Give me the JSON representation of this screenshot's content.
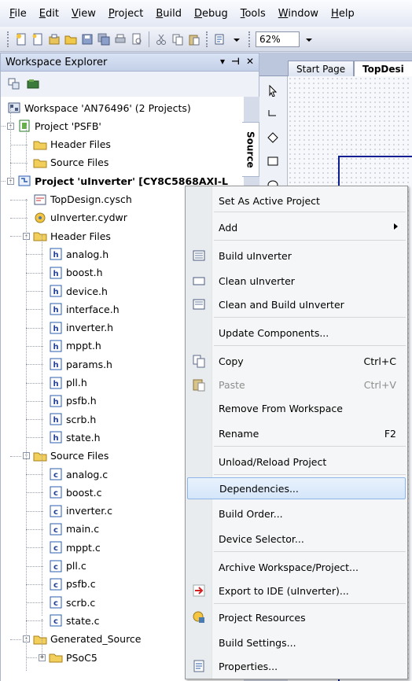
{
  "menubar": [
    "File",
    "Edit",
    "View",
    "Project",
    "Build",
    "Debug",
    "Tools",
    "Window",
    "Help"
  ],
  "toolbar": {
    "zoom": "62%"
  },
  "workspace_panel": {
    "title": "Workspace Explorer",
    "pin_label": "▾ ⊣ ✕",
    "side_tab": "Source"
  },
  "tree": {
    "workspace": "Workspace 'AN76496' (2 Projects)",
    "psfb_project": "Project 'PSFB'",
    "psfb_header": "Header Files",
    "psfb_source": "Source Files",
    "uinverter_project": "Project 'uInverter' [CY8C5868AXI-L",
    "topdesign": "TopDesign.cysch",
    "cydwr": "uInverter.cydwr",
    "header_files": "Header Files",
    "headers": [
      "analog.h",
      "boost.h",
      "device.h",
      "interface.h",
      "inverter.h",
      "mppt.h",
      "params.h",
      "pll.h",
      "psfb.h",
      "scrb.h",
      "state.h"
    ],
    "source_files": "Source Files",
    "sources": [
      "analog.c",
      "boost.c",
      "inverter.c",
      "main.c",
      "mppt.c",
      "pll.c",
      "psfb.c",
      "scrb.c",
      "state.c"
    ],
    "generated": "Generated_Source",
    "psoc5": "PSoC5"
  },
  "tabs": {
    "start": "Start Page",
    "design": "TopDesi"
  },
  "context_menu": {
    "set_active": "Set As Active Project",
    "add": "Add",
    "build": "Build uInverter",
    "clean": "Clean uInverter",
    "clean_build": "Clean and Build uInverter",
    "update": "Update Components...",
    "copy": "Copy",
    "copy_sc": "Ctrl+C",
    "paste": "Paste",
    "paste_sc": "Ctrl+V",
    "remove": "Remove From Workspace",
    "rename": "Rename",
    "rename_sc": "F2",
    "unload": "Unload/Reload Project",
    "dependencies": "Dependencies...",
    "build_order": "Build Order...",
    "device_selector": "Device Selector...",
    "archive": "Archive Workspace/Project...",
    "export": "Export to IDE (uInverter)...",
    "resources": "Project Resources",
    "build_settings": "Build Settings...",
    "properties": "Properties..."
  }
}
